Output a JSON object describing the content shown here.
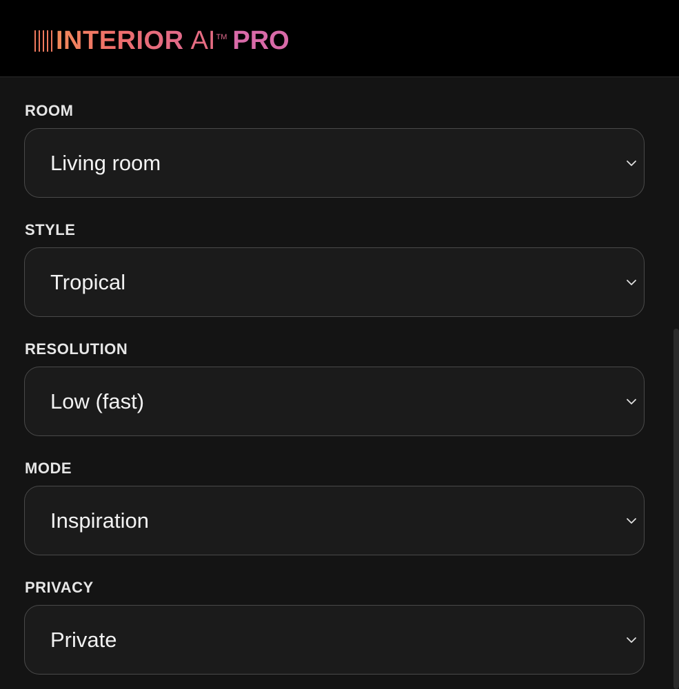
{
  "header": {
    "logo": {
      "word": "INTERIOR",
      "ai": "AI",
      "tm": "TM",
      "pro": "PRO",
      "gradient_start": "#f28a5a",
      "gradient_end": "#d86aa8"
    }
  },
  "form": {
    "fields": [
      {
        "label": "ROOM",
        "value": "Living room"
      },
      {
        "label": "STYLE",
        "value": "Tropical"
      },
      {
        "label": "RESOLUTION",
        "value": "Low (fast)"
      },
      {
        "label": "MODE",
        "value": "Inspiration"
      },
      {
        "label": "PRIVACY",
        "value": "Private"
      }
    ],
    "icons": {
      "dropdown": "chevron-down-icon"
    }
  },
  "colors": {
    "background": "#141414",
    "header_background": "#000000",
    "select_border": "#4a4a4a",
    "text": "#f2f2f2"
  }
}
